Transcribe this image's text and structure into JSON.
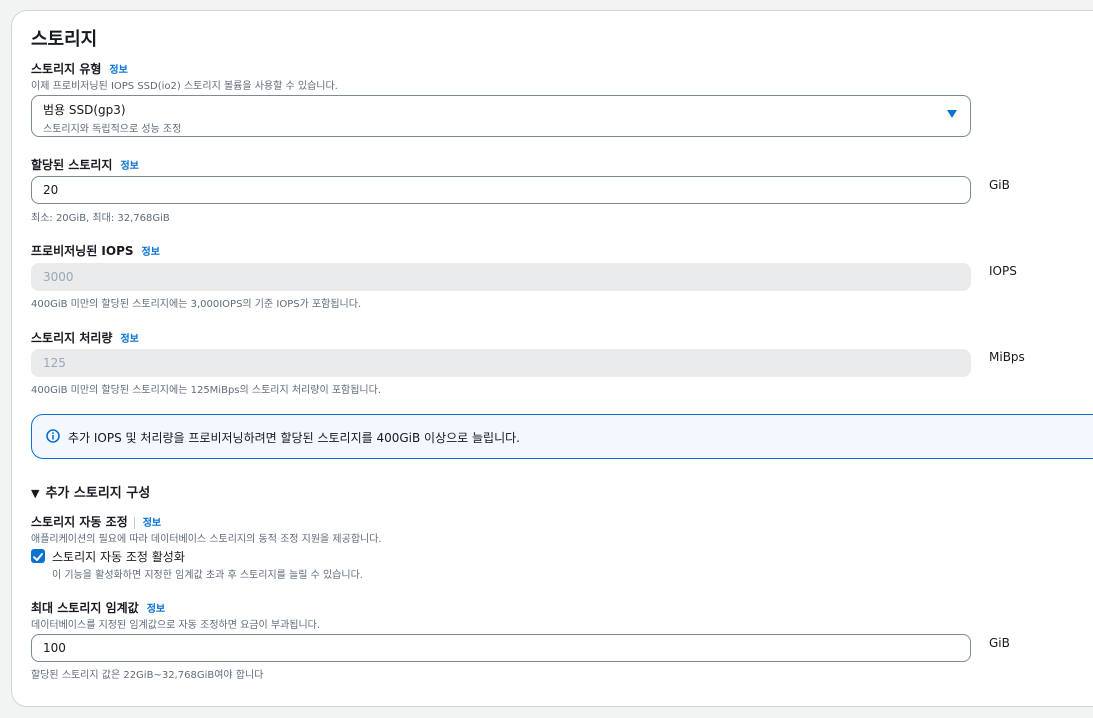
{
  "title": "스토리지",
  "info_label": "정보",
  "storage_type": {
    "label": "스토리지 유형",
    "description": "이제 프로비저닝된 IOPS SSD(io2) 스토리지 볼륨을 사용할 수 있습니다.",
    "selected_value": "범용 SSD(gp3)",
    "selected_description": "스토리지와 독립적으로 성능 조정"
  },
  "allocated_storage": {
    "label": "할당된 스토리지",
    "value": "20",
    "unit": "GiB",
    "hint": "최소: 20GiB, 최대: 32,768GiB"
  },
  "provisioned_iops": {
    "label": "프로비저닝된 IOPS",
    "value": "3000",
    "unit": "IOPS",
    "hint": "400GiB 미만의 할당된 스토리지에는 3,000IOPS의 기준 IOPS가 포함됩니다."
  },
  "storage_throughput": {
    "label": "스토리지 처리량",
    "value": "125",
    "unit": "MiBps",
    "hint": "400GiB 미만의 할당된 스토리지에는 125MiBps의 스토리지 처리량이 포함됩니다."
  },
  "alert": {
    "text": "추가 IOPS 및 처리량을 프로비저닝하려면 할당된 스토리지를 400GiB 이상으로 늘립니다."
  },
  "additional_config": {
    "label": "추가 스토리지 구성"
  },
  "autoscaling": {
    "label": "스토리지 자동 조정",
    "description": "애플리케이션의 필요에 따라 데이터베이스 스토리지의 동적 조정 지원을 제공합니다.",
    "checkbox_label": "스토리지 자동 조정 활성화",
    "checkbox_description": "이 기능을 활성화하면 지정한 임계값 초과 후 스토리지를 늘릴 수 있습니다.",
    "checked": true
  },
  "max_threshold": {
    "label": "최대 스토리지 임계값",
    "description": "데이터베이스를 지정된 임계값으로 자동 조정하면 요금이 부과됩니다.",
    "value": "100",
    "unit": "GiB",
    "hint": "할당된 스토리지 값은 22GiB~32,768GiB여야 합니다"
  },
  "colors": {
    "link": "#0972d3",
    "text": "#16191f",
    "muted": "#5f6b7a",
    "disabled_bg": "#e9ebed",
    "info_bg": "#f2f8fd"
  }
}
